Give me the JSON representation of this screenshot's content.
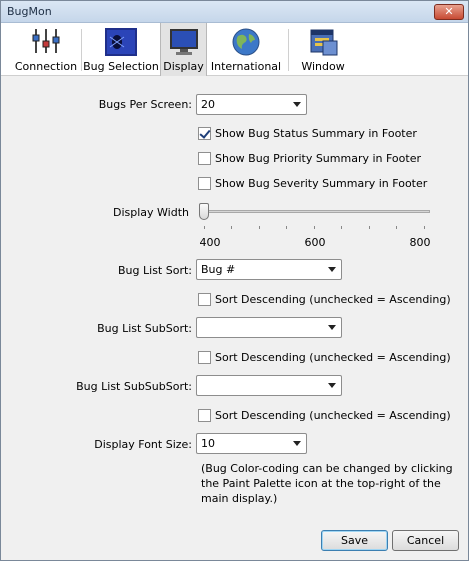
{
  "window": {
    "title": "BugMon",
    "close_glyph": "✕"
  },
  "toolbar": {
    "items": [
      {
        "label": "Connection",
        "icon": "connection-icon"
      },
      {
        "label": "Bug Selection",
        "icon": "bug-selection-icon"
      },
      {
        "label": "Display",
        "icon": "display-icon",
        "selected": true
      },
      {
        "label": "International",
        "icon": "globe-icon"
      },
      {
        "label": "Window",
        "icon": "window-icon"
      }
    ]
  },
  "form": {
    "bugs_per_screen": {
      "label": "Bugs Per Screen:",
      "value": "20"
    },
    "show_status": {
      "label": "Show Bug Status Summary in Footer",
      "checked": true
    },
    "show_priority": {
      "label": "Show Bug Priority Summary in Footer",
      "checked": false
    },
    "show_severity": {
      "label": "Show Bug Severity Summary in Footer",
      "checked": false
    },
    "display_width": {
      "label": "Display Width",
      "value": 400,
      "min": 400,
      "max": 800,
      "ticks": [
        "400",
        "600",
        "800"
      ]
    },
    "sort": {
      "label": "Bug List Sort:",
      "value": "Bug #"
    },
    "sort_desc": {
      "label": "Sort Descending (unchecked = Ascending)",
      "checked": false
    },
    "subsort": {
      "label": "Bug List SubSort:",
      "value": ""
    },
    "subsort_desc": {
      "label": "Sort Descending (unchecked = Ascending)",
      "checked": false
    },
    "subsubsort": {
      "label": "Bug List SubSubSort:",
      "value": ""
    },
    "subsubsort_desc": {
      "label": "Sort Descending (unchecked = Ascending)",
      "checked": false
    },
    "font_size": {
      "label": "Display Font Size:",
      "value": "10"
    },
    "note_lines": [
      "(Bug Color-coding can be changed by clicking",
      "the Paint Palette icon at the top-right of the",
      "main display.)"
    ]
  },
  "buttons": {
    "save": "Save",
    "cancel": "Cancel"
  },
  "colors": {
    "accent": "#3c7fb1",
    "window_bg": "#f0f0f0"
  }
}
